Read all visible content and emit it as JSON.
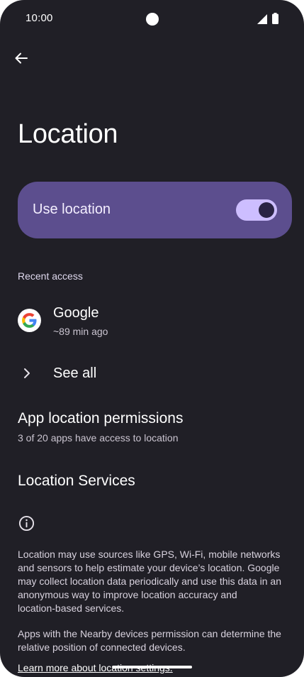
{
  "status_bar": {
    "time": "10:00"
  },
  "page": {
    "title": "Location"
  },
  "use_location": {
    "label": "Use location",
    "enabled": true,
    "accent_color": "#cdbeff",
    "card_color": "#5c4e8e"
  },
  "recent_access": {
    "header": "Recent access",
    "apps": [
      {
        "name": "Google",
        "time": "~89 min ago",
        "icon": "google-icon"
      }
    ],
    "see_all_label": "See all"
  },
  "app_location_permissions": {
    "title": "App location permissions",
    "subtitle": "3 of 20 apps have access to location"
  },
  "location_services": {
    "title": "Location Services"
  },
  "footer": {
    "paragraph1": "Location may use sources like GPS, Wi‑Fi, mobile networks and sensors to help estimate your device’s location. Google may collect location data periodically and use this data in an anonymous way to improve location accuracy and location‑based services.",
    "paragraph2": "Apps with the Nearby devices permission can determine the relative position of connected devices.",
    "learn_more": "Learn more about location settings."
  }
}
